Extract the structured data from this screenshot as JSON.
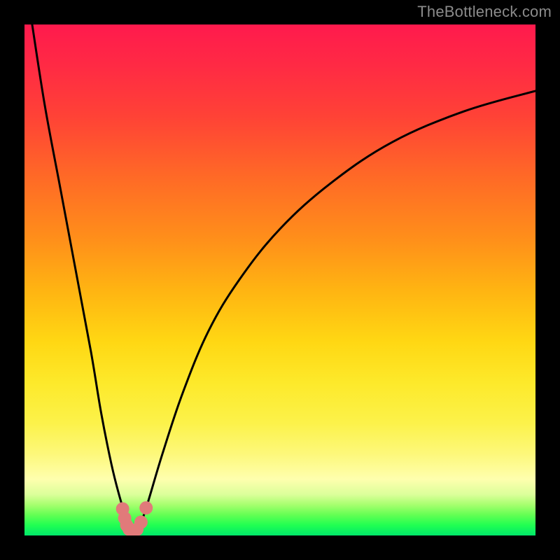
{
  "watermark": "TheBottleneck.com",
  "colors": {
    "background": "#000000",
    "curve": "#000000",
    "marker": "#e17a7a",
    "gradient_top": "#ff1a4d",
    "gradient_bottom": "#00e86a"
  },
  "chart_data": {
    "type": "line",
    "title": "",
    "xlabel": "",
    "ylabel": "",
    "xlim": [
      0,
      100
    ],
    "ylim": [
      0,
      100
    ],
    "grid": false,
    "series": [
      {
        "name": "left-branch",
        "x": [
          1.5,
          4,
          7,
          10,
          13,
          15,
          17,
          18.5,
          20,
          21
        ],
        "y": [
          100,
          84,
          68,
          52,
          36,
          24,
          14,
          8,
          3,
          0
        ]
      },
      {
        "name": "right-branch",
        "x": [
          22,
          24,
          27,
          31,
          36,
          42,
          50,
          60,
          72,
          86,
          100
        ],
        "y": [
          0,
          6,
          16,
          28,
          40,
          50,
          60,
          69,
          77,
          83,
          87
        ]
      }
    ],
    "markers": {
      "name": "highlight-region",
      "points": [
        {
          "x": 19.2,
          "y": 5.2
        },
        {
          "x": 19.6,
          "y": 3.4
        },
        {
          "x": 20.0,
          "y": 2.0
        },
        {
          "x": 20.5,
          "y": 1.2
        },
        {
          "x": 21.0,
          "y": 0.9
        },
        {
          "x": 21.5,
          "y": 0.9
        },
        {
          "x": 22.0,
          "y": 1.2
        },
        {
          "x": 22.8,
          "y": 2.6
        },
        {
          "x": 23.8,
          "y": 5.4
        }
      ],
      "radius_pct": 1.3
    }
  }
}
